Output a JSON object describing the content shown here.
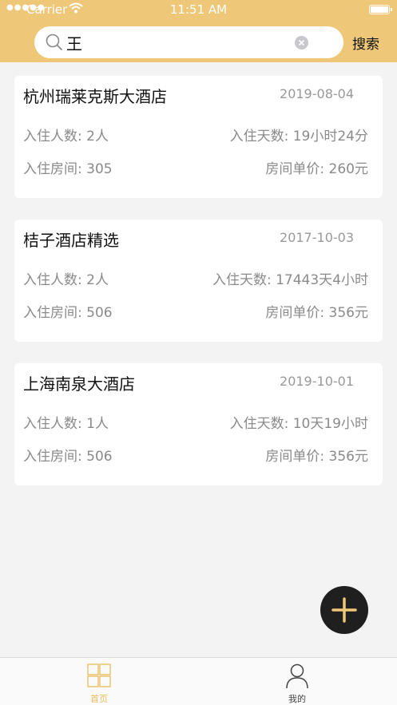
{
  "status_bar": {
    "carrier": "Carrier",
    "time": "11:51 AM"
  },
  "search": {
    "value": "王",
    "button_label": "搜索"
  },
  "records": [
    {
      "hotel": "杭州瑞莱克斯大酒店",
      "date": "2019-08-04",
      "guests": "入住人数: 2人",
      "duration": "入住天数: 19小时24分",
      "room": "入住房间: 305",
      "price": "房间单价: 260元"
    },
    {
      "hotel": "桔子酒店精选",
      "date": "2017-10-03",
      "guests": "入住人数: 2人",
      "duration": "入住天数: 17443天4小时",
      "room": "入住房间: 506",
      "price": "房间单价: 356元"
    },
    {
      "hotel": "上海南泉大酒店",
      "date": "2019-10-01",
      "guests": "入住人数: 1人",
      "duration": "入住天数: 10天19小时",
      "room": "入住房间: 506",
      "price": "房间单价: 356元"
    }
  ],
  "tabbar": {
    "home_label": "首页",
    "mine_label": "我的"
  },
  "colors": {
    "header": "#eec878",
    "accent": "#e8bc5c",
    "fab": "#1f1f1f"
  },
  "icons": [
    "wifi-icon",
    "battery-icon",
    "search-icon",
    "clear-icon",
    "add-icon",
    "home-grid-icon",
    "person-icon"
  ]
}
